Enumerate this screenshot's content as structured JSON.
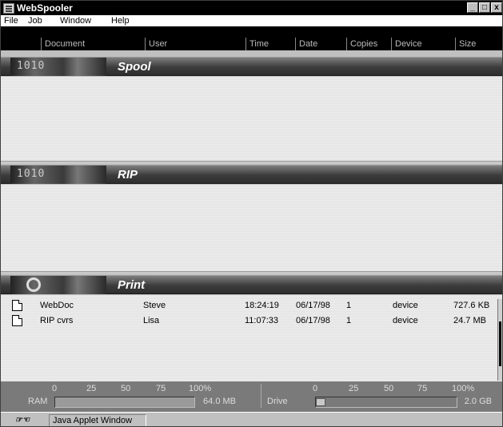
{
  "window": {
    "title": "WebSpooler",
    "minimize": "_",
    "maximize": "□",
    "close": "x"
  },
  "menu": [
    "File",
    "Job",
    "Window",
    "Help"
  ],
  "columns": [
    "Document",
    "User",
    "Time",
    "Date",
    "Copies",
    "Device",
    "Size"
  ],
  "sections": {
    "spool": {
      "title": "Spool",
      "art_text": "1010"
    },
    "rip": {
      "title": "RIP",
      "art_text": "1010"
    },
    "print": {
      "title": "Print"
    }
  },
  "print_jobs": [
    {
      "document": "WebDoc",
      "user": "Steve",
      "time": "18:24:19",
      "date": "06/17/98",
      "copies": "1",
      "device": "device",
      "size": "727.6 KB"
    },
    {
      "document": "RIP cvrs",
      "user": "Lisa",
      "time": "11:07:33",
      "date": "06/17/98",
      "copies": "1",
      "device": "device",
      "size": "24.7 MB"
    }
  ],
  "gauges": {
    "ticks": [
      "0",
      "25",
      "50",
      "75",
      "100%"
    ],
    "ram": {
      "label": "RAM",
      "total": "64.0 MB",
      "used_fraction": 1.0
    },
    "drive": {
      "label": "Drive",
      "total": "2.0 GB",
      "used_fraction": 0.0
    }
  },
  "status": {
    "icon_text": "☞☜",
    "text": "Java Applet Window"
  },
  "colors": {
    "titlebar": "#000000",
    "header": "#000000",
    "pane": "#e3e3e3",
    "gauge_panel": "#7a7a7a"
  },
  "icons": [
    "app-window-icon",
    "document-icon",
    "gear-icon",
    "applet-icon"
  ]
}
